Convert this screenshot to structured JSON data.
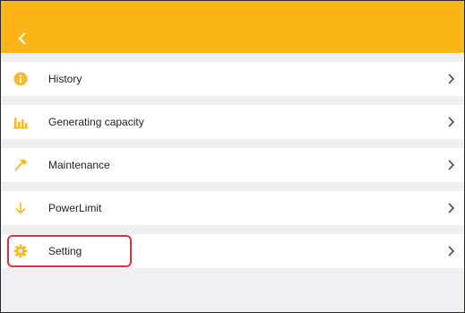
{
  "colors": {
    "header": "#fbb516",
    "accent_icon": "#f7b82a",
    "background": "#efeff4",
    "highlight": "#e0303a"
  },
  "header": {
    "back_icon": "chevron-left-icon"
  },
  "menu": {
    "items": [
      {
        "label": "History",
        "icon": "info-circle-icon"
      },
      {
        "label": "Generating capacity",
        "icon": "bar-chart-icon"
      },
      {
        "label": "Maintenance",
        "icon": "hammer-icon"
      },
      {
        "label": "PowerLimit",
        "icon": "arrow-down-icon"
      },
      {
        "label": "Setting",
        "icon": "gear-icon"
      }
    ]
  }
}
